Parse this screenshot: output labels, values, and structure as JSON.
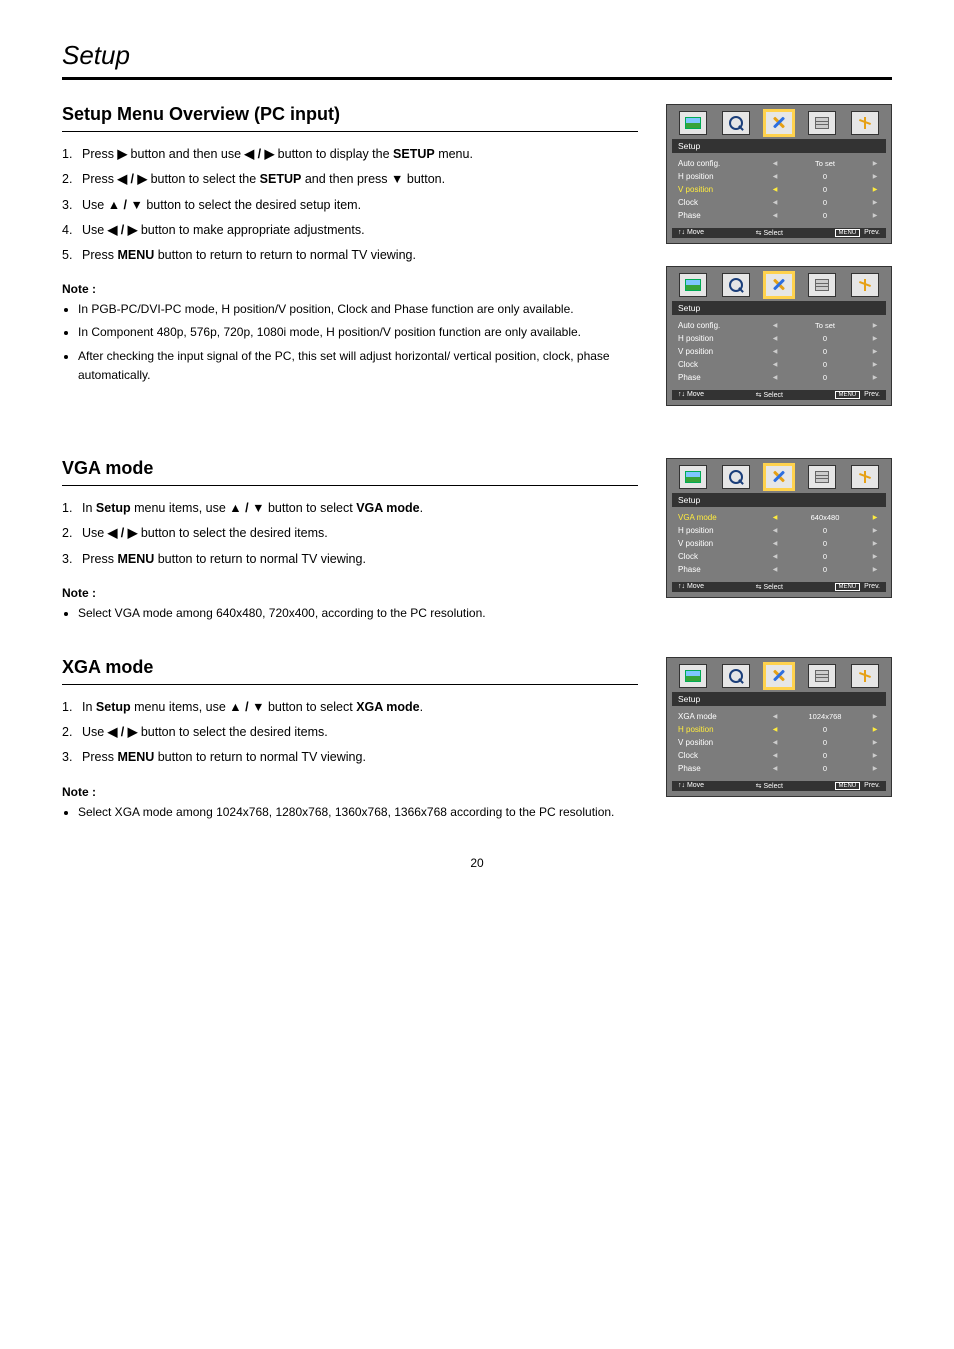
{
  "pageTitle": "Setup",
  "pageNumber": "20",
  "sections": [
    {
      "heading": "Setup Menu Overview (PC input)",
      "steps": [
        {
          "num": "1.",
          "html": "Press <b>▶</b> button and then use <b>◀ / ▶</b> button to display the <b>SETUP</b> menu."
        },
        {
          "num": "2.",
          "html": "Press <b>◀ / ▶</b> button to select the <b>SETUP</b> and then press <b>▼</b> button."
        },
        {
          "num": "3.",
          "html": "Use <b>▲ / ▼</b> button to select the desired setup item."
        },
        {
          "num": "4.",
          "html": "Use <b>◀ / ▶</b> button to make appropriate adjustments."
        },
        {
          "num": "5.",
          "html": "Press <b>MENU</b> button to return to return to normal TV viewing."
        }
      ],
      "notes": [
        "In PGB-PC/DVI-PC mode, H position/V position, Clock and Phase function are only available.",
        "In Component 480p, 576p, 720p, 1080i mode, H position/V position function are only available.",
        "After checking the input signal of the PC, this set will adjust horizontal/ vertical position, clock, phase automatically."
      ],
      "osds": [
        {
          "title": "Setup",
          "rows": [
            {
              "label": "Auto config.",
              "val": "To set",
              "hi": false
            },
            {
              "label": "H position",
              "val": "0",
              "hi": false
            },
            {
              "label": "V position",
              "val": "0",
              "hi": true
            },
            {
              "label": "Clock",
              "val": "0",
              "hi": false
            },
            {
              "label": "Phase",
              "val": "0",
              "hi": false
            }
          ],
          "foot": {
            "move": "Move",
            "select": "Select",
            "prev": "Prev.",
            "menu": "MENU"
          }
        },
        {
          "title": "Setup",
          "rows": [
            {
              "label": "Auto config.",
              "val": "To set",
              "hi": false
            },
            {
              "label": "H position",
              "val": "0",
              "hi": false
            },
            {
              "label": "V position",
              "val": "0",
              "hi": false
            },
            {
              "label": "Clock",
              "val": "0",
              "hi": false
            },
            {
              "label": "Phase",
              "val": "0",
              "hi": false
            }
          ],
          "foot": {
            "move": "Move",
            "select": "Select",
            "prev": "Prev.",
            "menu": "MENU"
          }
        }
      ]
    },
    {
      "heading": "VGA mode",
      "steps": [
        {
          "num": "1.",
          "html": "In <b>Setup</b> menu items, use <b>▲ / ▼</b> button to select <b>VGA mode</b>."
        },
        {
          "num": "2.",
          "html": "Use <b>◀ / ▶</b> button to select the desired items."
        },
        {
          "num": "3.",
          "html": "Press <b>MENU</b> button to return to normal TV viewing."
        }
      ],
      "notes": [
        "Select VGA mode among 640x480, 720x400, according to the PC resolution."
      ],
      "osds": [
        {
          "title": "Setup",
          "rows": [
            {
              "label": "VGA mode",
              "val": "640x480",
              "hi": true
            },
            {
              "label": "H position",
              "val": "0",
              "hi": false
            },
            {
              "label": "V position",
              "val": "0",
              "hi": false
            },
            {
              "label": "Clock",
              "val": "0",
              "hi": false
            },
            {
              "label": "Phase",
              "val": "0",
              "hi": false
            }
          ],
          "foot": {
            "move": "Move",
            "select": "Select",
            "prev": "Prev.",
            "menu": "MENU"
          }
        }
      ]
    },
    {
      "heading": "XGA mode",
      "steps": [
        {
          "num": "1.",
          "html": "In <b>Setup</b> menu items, use <b>▲ / ▼</b> button to select <b>XGA mode</b>."
        },
        {
          "num": "2.",
          "html": "Use <b>◀ / ▶</b> button to select the desired items."
        },
        {
          "num": "3.",
          "html": "Press <b>MENU</b> button to return to normal TV viewing."
        }
      ],
      "notes": [
        "Select XGA mode among 1024x768, 1280x768, 1360x768, 1366x768 according to the PC resolution."
      ],
      "osds": [
        {
          "title": "Setup",
          "rows": [
            {
              "label": "XGA mode",
              "val": "1024x768",
              "hi": false
            },
            {
              "label": "H position",
              "val": "0",
              "hi": true
            },
            {
              "label": "V position",
              "val": "0",
              "hi": false
            },
            {
              "label": "Clock",
              "val": "0",
              "hi": false
            },
            {
              "label": "Phase",
              "val": "0",
              "hi": false
            }
          ],
          "foot": {
            "move": "Move",
            "select": "Select",
            "prev": "Prev.",
            "menu": "MENU"
          }
        }
      ]
    }
  ]
}
